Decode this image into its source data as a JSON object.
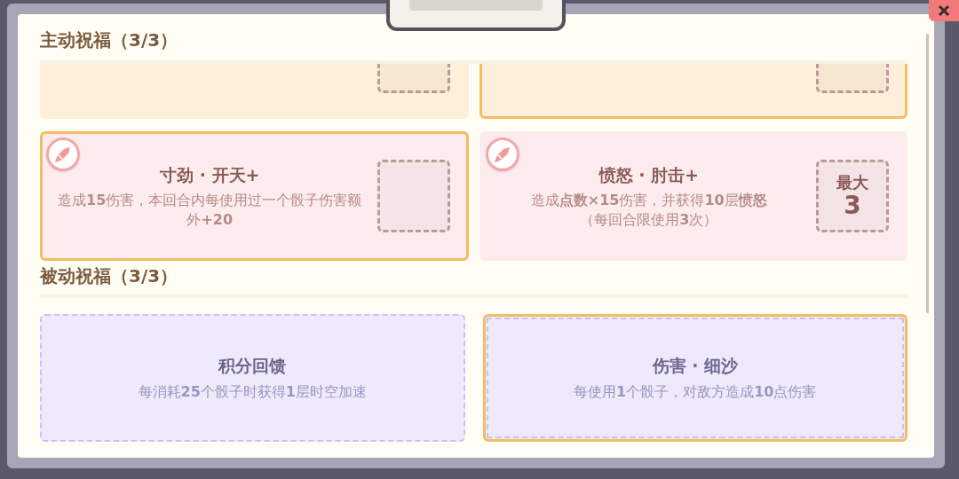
{
  "active_section": {
    "title": "主动祝福（3/3）",
    "cards": [
      {
        "color": "#fdefd9",
        "selected": false
      },
      {
        "color": "#fdefd9",
        "selected": true
      },
      {
        "color": "#fdecee",
        "selected": true,
        "icon": true,
        "title": "寸劲 · 开天+",
        "description": "造成**15**伤害，本回合内每使用过一个骰子伤害额外**+20**"
      },
      {
        "color": "#fdecee",
        "selected": false,
        "icon": true,
        "title": "愤怒 · 肘击+",
        "description": "造成**点数×15**伤害，并获得**10**层**愤怒**",
        "note": "（每回合限使用**3**次）",
        "slot": {
          "label": "最大",
          "value": "3"
        }
      }
    ]
  },
  "passive_section": {
    "title": "被动祝福（3/3）",
    "cards": [
      {
        "color": "#efeafb",
        "selected": false,
        "title": "积分回馈",
        "description": "每消耗**25**个骰子时获得**1**层时空加速"
      },
      {
        "color": "#efeafb",
        "selected": true,
        "title": "伤害 · 细沙",
        "description": "每使用**1**个骰子，对敌方造成**10**点伤害"
      }
    ]
  }
}
